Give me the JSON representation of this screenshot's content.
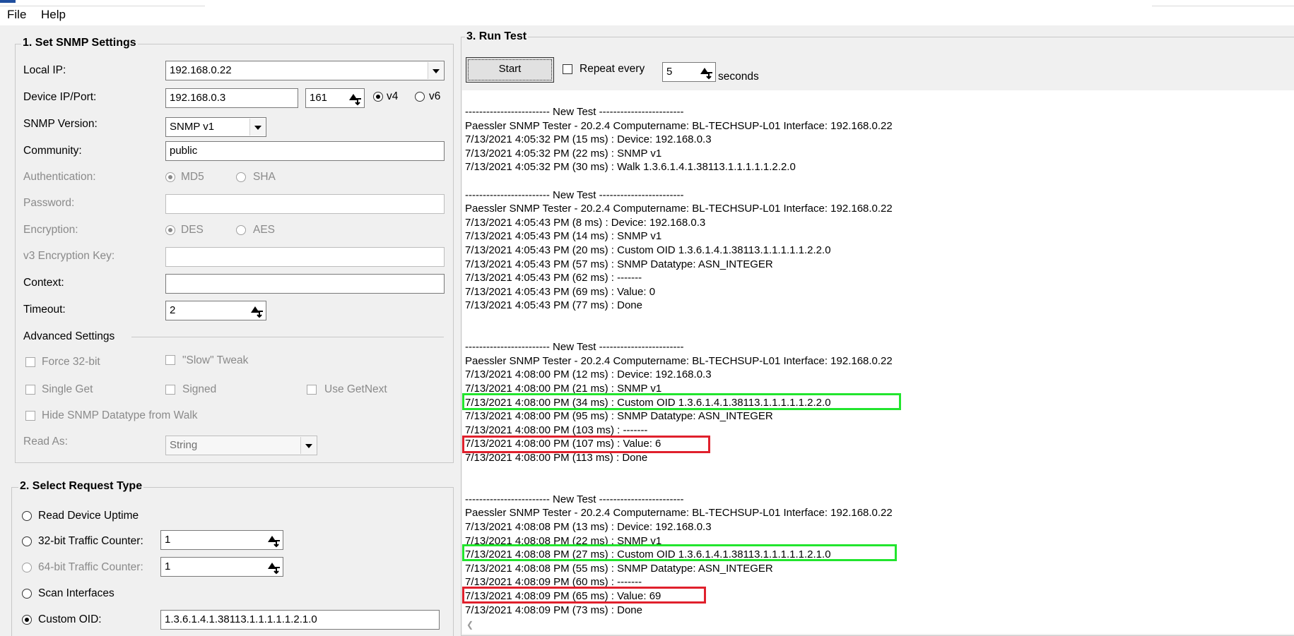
{
  "menu": {
    "file": "File",
    "help": "Help"
  },
  "snmp_settings": {
    "title": "1. Set SNMP Settings",
    "local_ip": {
      "label": "Local IP:",
      "value": "192.168.0.22"
    },
    "device": {
      "label": "Device IP/Port:",
      "ip": "192.168.0.3",
      "port": "161",
      "v4": "v4",
      "v6": "v6"
    },
    "snmp_version": {
      "label": "SNMP Version:",
      "value": "SNMP v1"
    },
    "community": {
      "label": "Community:",
      "value": "public"
    },
    "authentication": {
      "label": "Authentication:",
      "md5": "MD5",
      "sha": "SHA"
    },
    "password": {
      "label": "Password:",
      "value": ""
    },
    "encryption": {
      "label": "Encryption:",
      "des": "DES",
      "aes": "AES"
    },
    "v3_key": {
      "label": "v3 Encryption Key:",
      "value": ""
    },
    "context": {
      "label": "Context:",
      "value": ""
    },
    "timeout": {
      "label": "Timeout:",
      "value": "2"
    },
    "advanced": {
      "label": "Advanced Settings",
      "force32": "Force 32-bit",
      "slow_tweak": "\"Slow\" Tweak",
      "single_get": "Single Get",
      "signed": "Signed",
      "use_getnext": "Use GetNext",
      "hide_datatype": "Hide SNMP Datatype from Walk"
    },
    "read_as": {
      "label": "Read As:",
      "value": "String"
    }
  },
  "request_type": {
    "title": "2. Select Request Type",
    "uptime": "Read Device Uptime",
    "traffic32": {
      "label": "32-bit Traffic Counter:",
      "value": "1"
    },
    "traffic64": {
      "label": "64-bit Traffic Counter:",
      "value": "1"
    },
    "scan": "Scan Interfaces",
    "custom_oid": {
      "label": "Custom OID:",
      "value": "1.3.6.1.4.1.38113.1.1.1.1.1.2.1.0"
    }
  },
  "run_test": {
    "title": "3. Run Test",
    "start": "Start",
    "repeat": "Repeat every",
    "interval": "5",
    "seconds": "seconds"
  },
  "log": [
    "------------------------ New Test ------------------------",
    "Paessler SNMP Tester - 20.2.4 Computername: BL-TECHSUP-L01 Interface: 192.168.0.22",
    "7/13/2021 4:05:32 PM (15 ms) : Device: 192.168.0.3",
    "7/13/2021 4:05:32 PM (22 ms) : SNMP v1",
    "7/13/2021 4:05:32 PM (30 ms) : Walk 1.3.6.1.4.1.38113.1.1.1.1.1.2.2.0",
    "",
    "------------------------ New Test ------------------------",
    "Paessler SNMP Tester - 20.2.4 Computername: BL-TECHSUP-L01 Interface: 192.168.0.22",
    "7/13/2021 4:05:43 PM (8 ms) : Device: 192.168.0.3",
    "7/13/2021 4:05:43 PM (14 ms) : SNMP v1",
    "7/13/2021 4:05:43 PM (20 ms) : Custom OID 1.3.6.1.4.1.38113.1.1.1.1.1.2.2.0",
    "7/13/2021 4:05:43 PM (57 ms) : SNMP Datatype: ASN_INTEGER",
    "7/13/2021 4:05:43 PM (62 ms) : -------",
    "7/13/2021 4:05:43 PM (69 ms) : Value: 0",
    "7/13/2021 4:05:43 PM (77 ms) : Done",
    "",
    "",
    "------------------------ New Test ------------------------",
    "Paessler SNMP Tester - 20.2.4 Computername: BL-TECHSUP-L01 Interface: 192.168.0.22",
    "7/13/2021 4:08:00 PM (12 ms) : Device: 192.168.0.3",
    "7/13/2021 4:08:00 PM (21 ms) : SNMP v1",
    "7/13/2021 4:08:00 PM (34 ms) : Custom OID 1.3.6.1.4.1.38113.1.1.1.1.1.2.2.0",
    "7/13/2021 4:08:00 PM (95 ms) : SNMP Datatype: ASN_INTEGER",
    "7/13/2021 4:08:00 PM (103 ms) : -------",
    "7/13/2021 4:08:00 PM (107 ms) : Value: 6",
    "7/13/2021 4:08:00 PM (113 ms) : Done",
    "",
    "",
    "------------------------ New Test ------------------------",
    "Paessler SNMP Tester - 20.2.4 Computername: BL-TECHSUP-L01 Interface: 192.168.0.22",
    "7/13/2021 4:08:08 PM (13 ms) : Device: 192.168.0.3",
    "7/13/2021 4:08:08 PM (22 ms) : SNMP v1",
    "7/13/2021 4:08:08 PM (27 ms) : Custom OID 1.3.6.1.4.1.38113.1.1.1.1.1.2.1.0",
    "7/13/2021 4:08:08 PM (55 ms) : SNMP Datatype: ASN_INTEGER",
    "7/13/2021 4:08:09 PM (60 ms) : -------",
    "7/13/2021 4:08:09 PM (65 ms) : Value: 69",
    "7/13/2021 4:08:09 PM (73 ms) : Done"
  ],
  "colors": {
    "green_highlight": "#22e52e",
    "red_highlight": "#e0202c"
  }
}
